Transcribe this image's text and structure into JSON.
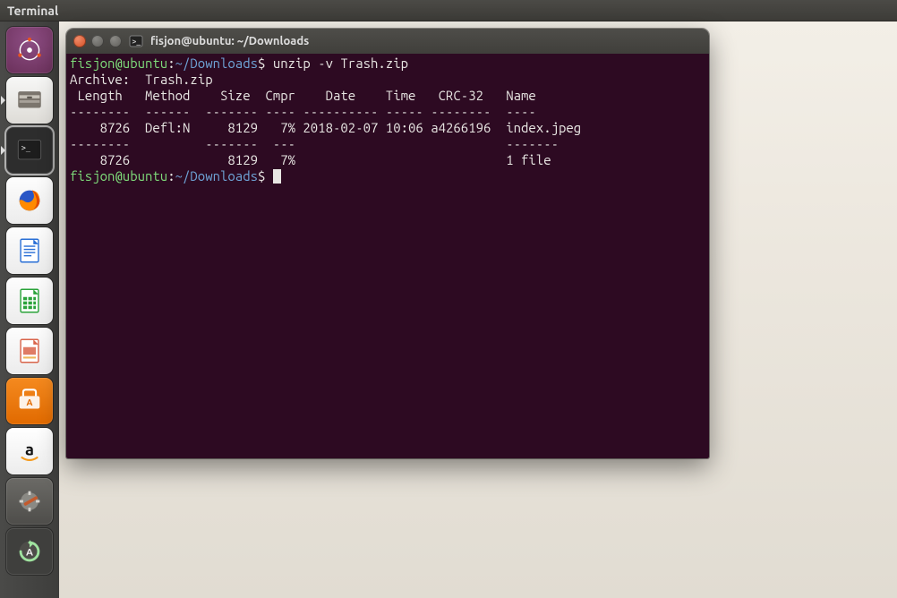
{
  "menubar": {
    "title": "Terminal"
  },
  "launcher": {
    "items": [
      {
        "name": "dash-icon"
      },
      {
        "name": "files-icon"
      },
      {
        "name": "terminal-icon"
      },
      {
        "name": "firefox-icon"
      },
      {
        "name": "libreoffice-writer-icon"
      },
      {
        "name": "libreoffice-calc-icon"
      },
      {
        "name": "libreoffice-impress-icon"
      },
      {
        "name": "ubuntu-software-icon"
      },
      {
        "name": "amazon-icon"
      },
      {
        "name": "system-settings-icon"
      },
      {
        "name": "software-updater-icon"
      }
    ]
  },
  "terminal": {
    "title": "fisjon@ubuntu: ~/Downloads",
    "prompt_user": "fisjon@ubuntu",
    "prompt_sep1": ":",
    "prompt_path": "~/Downloads",
    "prompt_sep2": "$ ",
    "command": "unzip -v Trash.zip",
    "archive_label": "Archive:  ",
    "archive_name": "Trash.zip",
    "header": " Length   Method    Size  Cmpr    Date    Time   CRC-32   Name",
    "rule1": "--------  ------  ------- ---- ---------- ----- --------  ----",
    "row": "    8726  Defl:N     8129   7% 2018-02-07 10:06 a4266196  index.jpeg",
    "rule2": "--------          -------  ---                            -------",
    "total": "    8726             8129   7%                            1 file"
  }
}
